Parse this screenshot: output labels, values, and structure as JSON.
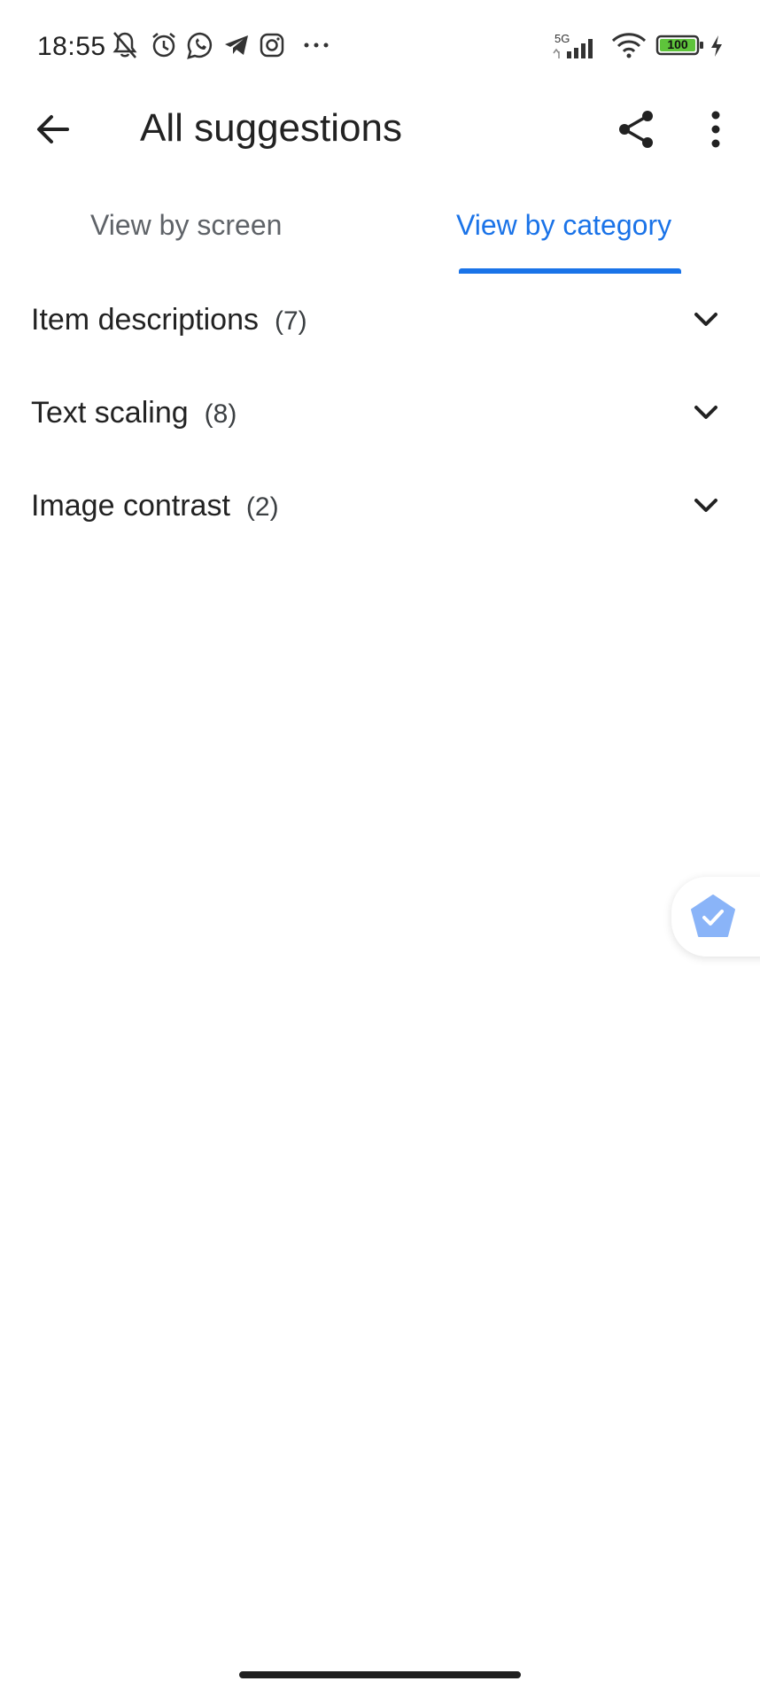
{
  "status_bar": {
    "time": "18:55",
    "network": "5G",
    "battery": "100",
    "icons": [
      "mute-icon",
      "alarm-icon",
      "whatsapp-icon",
      "telegram-icon",
      "instagram-icon",
      "more-dots-icon",
      "signal-icon",
      "wifi-icon",
      "battery-icon",
      "charging-icon"
    ]
  },
  "app_bar": {
    "title": "All suggestions",
    "back_icon": "arrow-back-icon",
    "share_icon": "share-icon",
    "more_icon": "more-vert-icon"
  },
  "tabs": [
    {
      "label": "View by screen",
      "selected": false
    },
    {
      "label": "View by category",
      "selected": true
    }
  ],
  "categories": [
    {
      "name": "Item descriptions",
      "count": "(7)"
    },
    {
      "name": "Text scaling",
      "count": "(8)"
    },
    {
      "name": "Image contrast",
      "count": "(2)"
    }
  ],
  "colors": {
    "accent": "#1a73e8",
    "fab_icon": "#8ab4f8"
  }
}
